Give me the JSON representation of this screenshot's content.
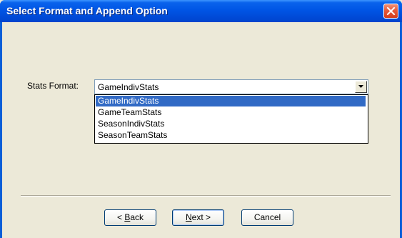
{
  "window": {
    "title": "Select Format and Append Option"
  },
  "stats_format": {
    "label": "Stats Format:",
    "selected": "GameIndivStats",
    "options": [
      "GameIndivStats",
      "GameTeamStats",
      "SeasonIndivStats",
      "SeasonTeamStats"
    ]
  },
  "buttons": {
    "back": {
      "prefix": "< ",
      "accel": "B",
      "rest": "ack"
    },
    "next": {
      "accel": "N",
      "rest": "ext >"
    },
    "cancel": {
      "label": "Cancel"
    }
  },
  "colors": {
    "titlebar": "#0055e5",
    "selection": "#316ac5",
    "dialog_bg": "#ece9d8"
  },
  "icons": {
    "close": "close-icon",
    "dropdown_arrow": "chevron-down-icon"
  }
}
